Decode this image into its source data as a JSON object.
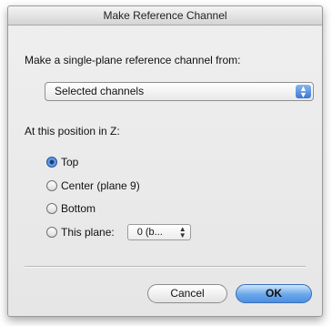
{
  "dialog": {
    "title": "Make Reference Channel",
    "prompt": "Make a single-plane reference channel from:",
    "source_popup": {
      "selected": "Selected channels"
    },
    "z_label": "At this position in Z:",
    "options": [
      {
        "label": "Top",
        "selected": true
      },
      {
        "label": "Center (plane 9)",
        "selected": false
      },
      {
        "label": "Bottom",
        "selected": false
      },
      {
        "label": "This plane:",
        "selected": false
      }
    ],
    "plane_stepper": {
      "value": "0 (b..."
    },
    "buttons": {
      "cancel": "Cancel",
      "ok": "OK"
    }
  }
}
